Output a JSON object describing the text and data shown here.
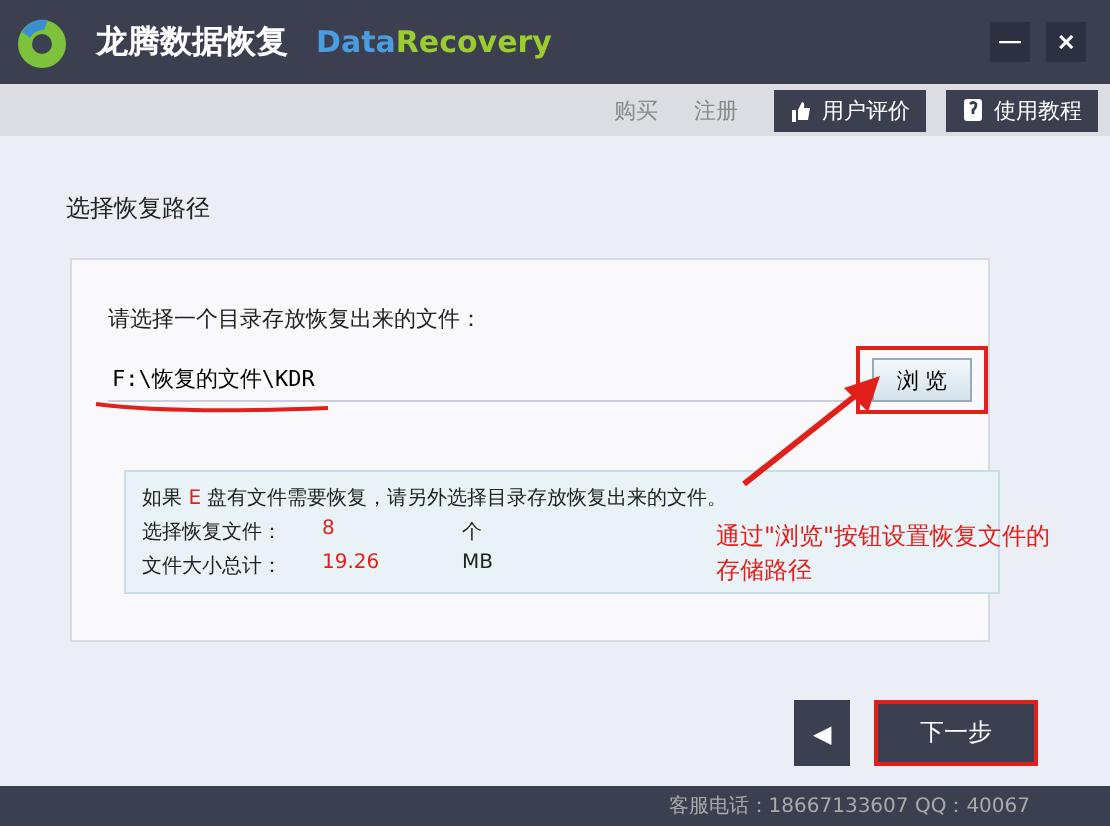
{
  "window": {
    "title": "龙腾数据恢复",
    "brand_part_1": "Data",
    "brand_part_2": "Recovery",
    "controls": [
      "—",
      "✕"
    ]
  },
  "toolbar": {
    "links": [
      "购买",
      "注册"
    ],
    "buttons": [
      {
        "kind": "thumb",
        "label": "用户评价"
      },
      {
        "kind": "book",
        "label": "使用教程"
      }
    ]
  },
  "section_title": "选择恢复路径",
  "path_panel": {
    "prompt": "请选择一个目录存放恢复出来的文件：",
    "path": "F:\\恢复的文件\\KDR",
    "browse_button": "浏  览"
  },
  "info": {
    "line_1_before": "如果",
    "drive": "E",
    "line_1_after": "盘有文件需要恢复，请另外选择目录存放恢复出来的文件。",
    "rows": [
      {
        "label": "选择恢复文件：",
        "value": "8",
        "unit": "个"
      },
      {
        "label": "文件大小总计：",
        "value": "19.26",
        "unit": "MB"
      }
    ]
  },
  "annotation": {
    "text": "通过\"浏览\"按钮设置恢复文件的存储路径"
  },
  "nav": {
    "back": "◀",
    "next": "下一步"
  },
  "status_bar": "客服电话：18667133607  QQ：40067"
}
